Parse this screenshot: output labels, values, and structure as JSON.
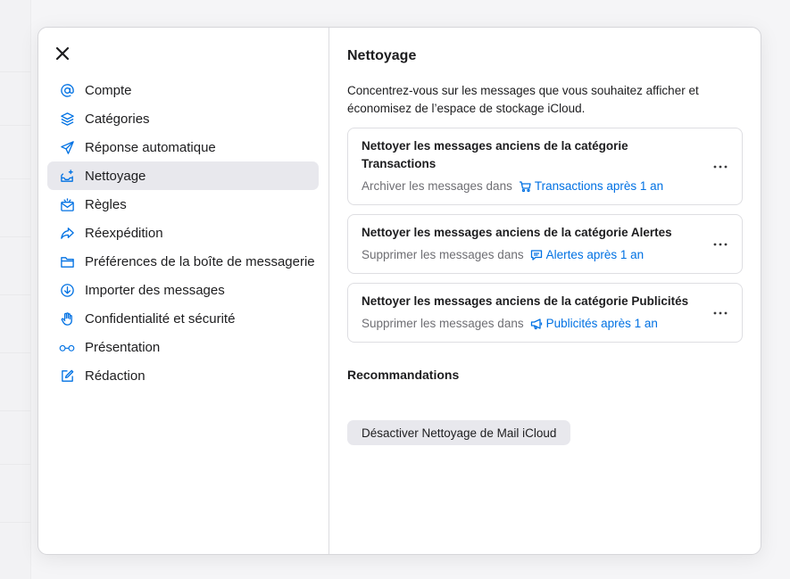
{
  "nav": {
    "items": [
      {
        "label": "Compte",
        "icon": "at-icon"
      },
      {
        "label": "Catégories",
        "icon": "stack-icon"
      },
      {
        "label": "Réponse automatique",
        "icon": "paper-plane-icon"
      },
      {
        "label": "Nettoyage",
        "icon": "mailbox-sparkle-icon",
        "active": true
      },
      {
        "label": "Règles",
        "icon": "envelope-rules-icon"
      },
      {
        "label": "Réexpédition",
        "icon": "forward-arrow-icon"
      },
      {
        "label": "Préférences de la boîte de messagerie",
        "icon": "folder-icon"
      },
      {
        "label": "Importer des messages",
        "icon": "import-circle-icon"
      },
      {
        "label": "Confidentialité et sécurité",
        "icon": "hand-icon"
      },
      {
        "label": "Présentation",
        "icon": "glasses-icon"
      },
      {
        "label": "Rédaction",
        "icon": "compose-icon"
      }
    ]
  },
  "main": {
    "title": "Nettoyage",
    "description": "Concentrez-vous sur les messages que vous souhaitez afficher et économisez de l’espace de stockage iCloud.",
    "cards": [
      {
        "title": "Nettoyer les messages anciens de la catégorie Transactions",
        "action": "Archiver les messages dans",
        "link": "Transactions après 1 an",
        "link_icon": "cart-icon"
      },
      {
        "title": "Nettoyer les messages anciens de la catégorie Alertes",
        "action": "Supprimer les messages dans",
        "link": "Alertes après 1 an",
        "link_icon": "message-bubble-icon"
      },
      {
        "title": "Nettoyer les messages anciens de la catégorie Publicités",
        "action": "Supprimer les messages dans",
        "link": "Publicités après 1 an",
        "link_icon": "megaphone-icon"
      }
    ],
    "more_label": "···",
    "recommendations_title": "Recommandations",
    "disable_button": "Désactiver Nettoyage de Mail iCloud"
  },
  "colors": {
    "accent": "#0071e3",
    "active_bg": "#e8e8ed",
    "secondary_text": "#6e6e73"
  }
}
